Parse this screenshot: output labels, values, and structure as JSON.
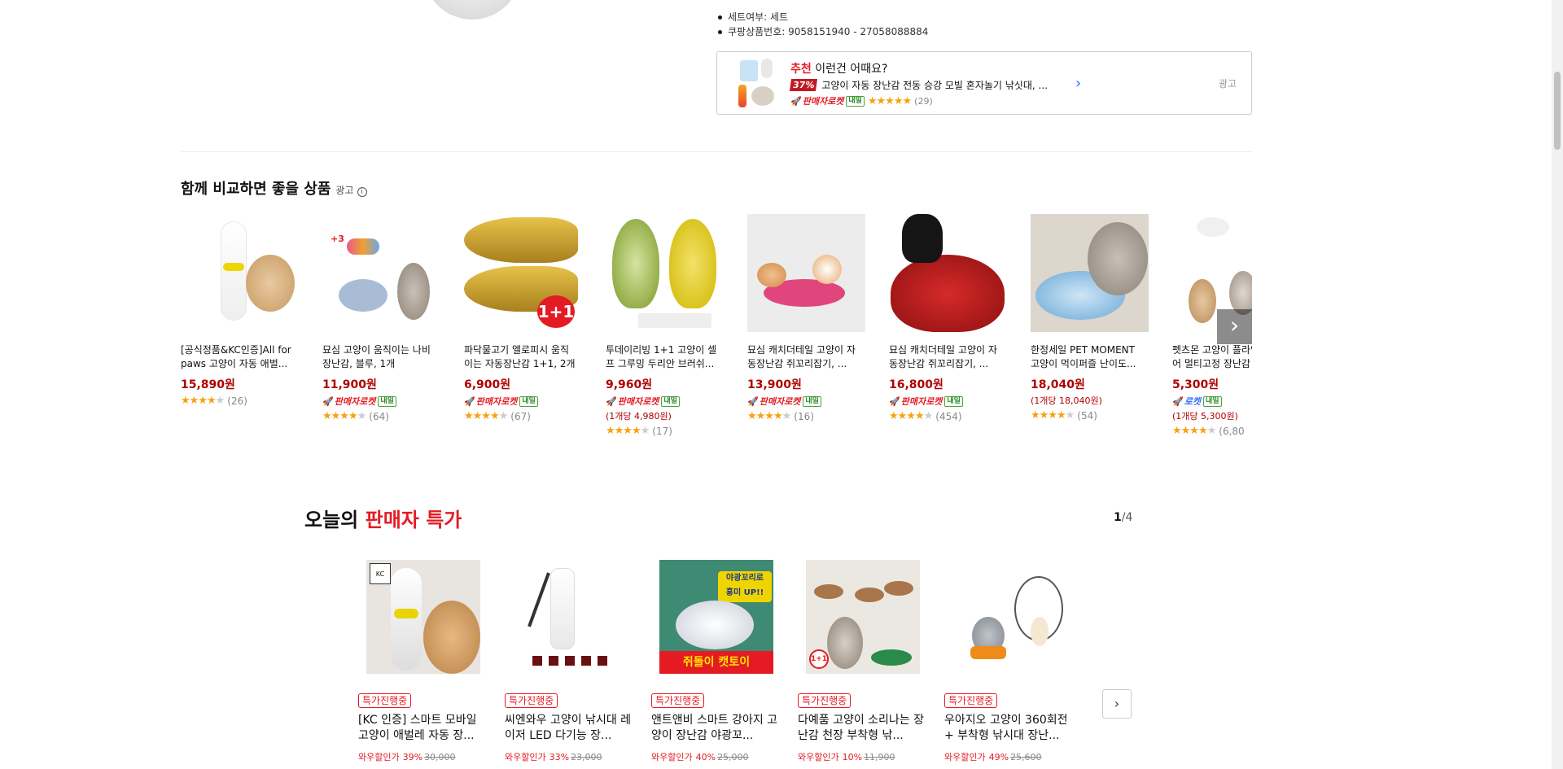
{
  "specs": [
    "세트여부: 세트",
    "쿠팡상품번호: 9058151940 - 27058088884"
  ],
  "recommend": {
    "label_hl": "추천",
    "label_rest": "이런건 어때요?",
    "discount": "37%",
    "product": "고양이 자동 장난감 전동 승강 모빌 혼자놀기 낚싯대, ...",
    "seller_rocket": "판매자로켓",
    "delivery": "내일",
    "reviews": "(29)",
    "ad_label": "광고"
  },
  "compare": {
    "title": "함께 비교하면 좋을 상품",
    "ad_tag": "광고",
    "items": [
      {
        "name": "[공식정품&KC인증]All for paws 고양이 자동 애벌...",
        "price": "15,890원",
        "unit": "",
        "rocket": "",
        "delivery": "",
        "stars": 4,
        "reviews": "(26)"
      },
      {
        "name": "묘심 고양이 움직이는 나비 장난감, 블루, 1개",
        "price": "11,900원",
        "unit": "",
        "rocket": "판매자로켓",
        "delivery": "내일",
        "stars": 4.5,
        "reviews": "(64)"
      },
      {
        "name": "파닥물고기 엘로피시 움직이는 자동장난감 1+1, 2개",
        "price": "6,900원",
        "unit": "",
        "rocket": "판매자로켓",
        "delivery": "내일",
        "stars": 4.5,
        "reviews": "(67)"
      },
      {
        "name": "투데이리빙 1+1 고양이 셀프 그루밍 두리안 브러쉬...",
        "price": "9,960원",
        "unit": "(1개당 4,980원)",
        "rocket": "판매자로켓",
        "delivery": "내일",
        "stars": 4,
        "reviews": "(17)"
      },
      {
        "name": "묘심 캐치더테일 고양이 자동장난감 쥐꼬리잡기, ...",
        "price": "13,900원",
        "unit": "",
        "rocket": "판매자로켓",
        "delivery": "내일",
        "stars": 4,
        "reviews": "(16)"
      },
      {
        "name": "묘심 캐치더테일 고양이 자동장난감 쥐꼬리잡기, ...",
        "price": "16,800원",
        "unit": "",
        "rocket": "판매자로켓",
        "delivery": "내일",
        "stars": 4.5,
        "reviews": "(454)"
      },
      {
        "name": "한정세일 PET MOMENT 고양이 먹이퍼즐 난이도...",
        "price": "18,040원",
        "unit": "(1개당 18,040원)",
        "rocket": "",
        "delivery": "",
        "stars": 4.5,
        "reviews": "(54)"
      },
      {
        "name": "펫츠몬 고양이 플라잉 와이어 멀티고정 장난감",
        "price": "5,300원",
        "unit": "(1개당 5,300원)",
        "rocket": "로켓",
        "delivery": "내일",
        "stars": 4.5,
        "reviews": "(6,80"
      }
    ],
    "next_icon": "chevron-right-icon"
  },
  "deals": {
    "title_a": "오늘의",
    "title_b": "판매자 특가",
    "page_current": "1",
    "page_total": "/4",
    "items": [
      {
        "badge": "특가진행중",
        "name": "[KC 인증] 스마트 모바일 고양이 애벌레 자동 장...",
        "label": "와우할인가",
        "pct": "39%",
        "orig": "30,000"
      },
      {
        "badge": "특가진행중",
        "name": "씨엔와우 고양이 낚시대 레이저 LED 다기능 장...",
        "label": "와우할인가",
        "pct": "33%",
        "orig": "23,000"
      },
      {
        "badge": "특가진행중",
        "name": "앤트앤비 스마트 강아지 고양이 장난감 야광꼬...",
        "label": "와우할인가",
        "pct": "40%",
        "orig": "25,000"
      },
      {
        "badge": "특가진행중",
        "name": "다예품 고양이 소리나는 장난감 천장 부착형 낚...",
        "label": "와우할인가",
        "pct": "10%",
        "orig": "11,900"
      },
      {
        "badge": "특가진행중",
        "name": "우아지오 고양이 360회전 + 부착형 낚시대 장난...",
        "label": "와우할인가",
        "pct": "49%",
        "orig": "25,600"
      }
    ],
    "img_text": {
      "glow_a": "야광꼬리로",
      "glow_b": "흥미 UP!!",
      "toy": "쥐돌이 캣토이",
      "plus": "1+1",
      "kc": "KC"
    }
  },
  "compare_img_text": {
    "one_plus_one": "1+1",
    "plus3": "+3"
  },
  "colors": {
    "price_red": "#ae0000",
    "accent_red": "#e41b23",
    "rocket_blue": "#346aff",
    "star": "#f8a10e"
  }
}
